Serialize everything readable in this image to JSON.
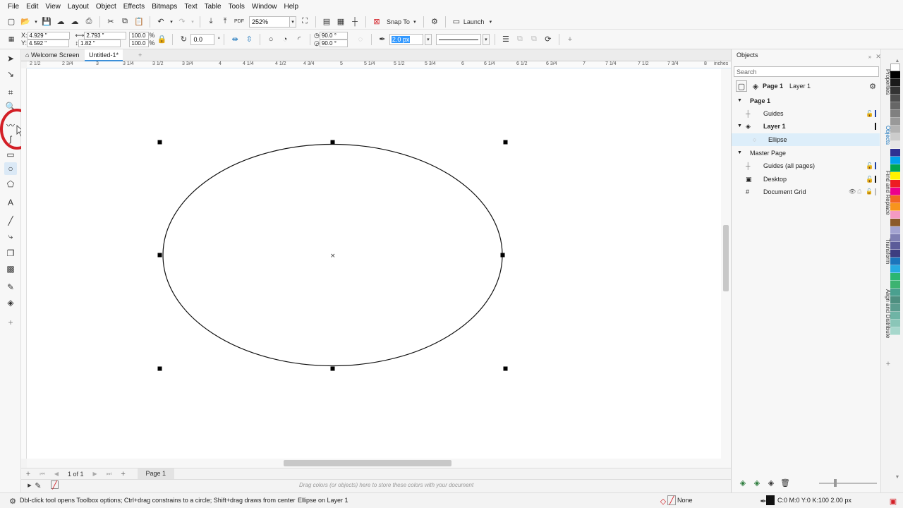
{
  "menubar": {
    "items": [
      "File",
      "Edit",
      "View",
      "Layout",
      "Object",
      "Effects",
      "Bitmaps",
      "Text",
      "Table",
      "Tools",
      "Window",
      "Help"
    ]
  },
  "toolbar": {
    "zoom": "252%",
    "snap_to": "Snap To",
    "launch": "Launch"
  },
  "property_bar": {
    "x": "4.929 \"",
    "y": "4.592 \"",
    "width": "2.793 \"",
    "height": "1.82 \"",
    "scale_x": "100.0",
    "scale_y": "100.0",
    "percent": "%",
    "rotation": "0.0",
    "degree": "°",
    "start_angle": "90.0 °",
    "end_angle": "90.0 °",
    "outline_width": "2.0 px"
  },
  "tabs": {
    "welcome": "Welcome Screen",
    "untitled": "Untitled-1*"
  },
  "ruler": {
    "h_labels": [
      "2 1/2",
      "2 3/4",
      "3",
      "3 1/4",
      "3 1/2",
      "3 3/4",
      "4",
      "4 1/4",
      "4 1/2",
      "4 3/4",
      "5",
      "5 1/4",
      "5 1/2",
      "5 3/4",
      "6",
      "6 1/4",
      "6 1/2",
      "6 3/4",
      "7",
      "7 1/4",
      "7 1/2",
      "7 3/4",
      "8"
    ],
    "unit": "inches"
  },
  "pagenav": {
    "counter": "1 of 1",
    "page_tab": "Page 1"
  },
  "colorwell": {
    "hint": "Drag colors (or objects) here to store these colors with your document"
  },
  "status": {
    "hint": "Dbl-click tool opens Toolbox options; Ctrl+drag constrains to a circle; Shift+drag draws from center",
    "selection": "Ellipse on Layer 1",
    "fill": "None",
    "outline": "C:0 M:0 Y:0 K:100  2.00 px"
  },
  "docker": {
    "title": "Objects",
    "search_placeholder": "Search",
    "current_page": "Page 1",
    "current_layer": "Layer 1",
    "tree": {
      "page1": "Page 1",
      "guides": "Guides",
      "layer1": "Layer 1",
      "ellipse": "Ellipse",
      "master": "Master Page",
      "guides_all": "Guides (all pages)",
      "desktop": "Desktop",
      "grid": "Document Grid"
    },
    "side_tabs": [
      "Properties",
      "Objects",
      "Find and Replace",
      "Transform",
      "Align and Distribute"
    ]
  },
  "palette": [
    "#ffffff",
    "#000000",
    "#1a1a1a",
    "#333333",
    "#4d4d4d",
    "#666666",
    "#808080",
    "#999999",
    "#b3b3b3",
    "#cccccc",
    "#e6e6e6",
    "#2e3192",
    "#00a0e9",
    "#00a651",
    "#fff200",
    "#ed1c24",
    "#ec008c",
    "#f26522",
    "#f7941d",
    "#f49ac2",
    "#8b5a2b",
    "#a3a3d1",
    "#7f7fb3",
    "#5c5c99",
    "#3d3d80",
    "#1b75bc",
    "#27aae1",
    "#2bb673",
    "#3cb371",
    "#4aa08f",
    "#4e8f80",
    "#5b9c8e",
    "#6fb4a5",
    "#8ac6b8",
    "#a7d7cc"
  ],
  "colors": {
    "accent": "#d31f26",
    "selection_blue": "#ddeefa"
  }
}
